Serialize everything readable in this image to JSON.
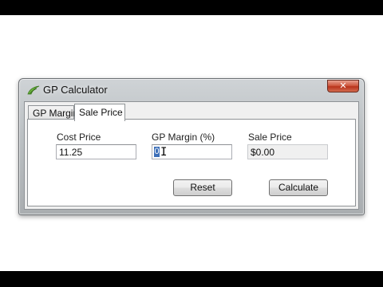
{
  "window": {
    "title": "GP Calculator",
    "close_label": "✕"
  },
  "tabs": [
    {
      "label": "GP Margin",
      "active": false
    },
    {
      "label": "Sale Price",
      "active": true
    }
  ],
  "form": {
    "cost_price": {
      "label": "Cost Price",
      "value": "11.25"
    },
    "gp_margin": {
      "label": "GP Margin (%)",
      "value": "0"
    },
    "sale_price": {
      "label": "Sale Price",
      "value": "$0.00"
    }
  },
  "buttons": {
    "reset": "Reset",
    "calculate": "Calculate"
  },
  "colors": {
    "accent_selection": "#3d6fb8",
    "close_button": "#c7432a"
  }
}
